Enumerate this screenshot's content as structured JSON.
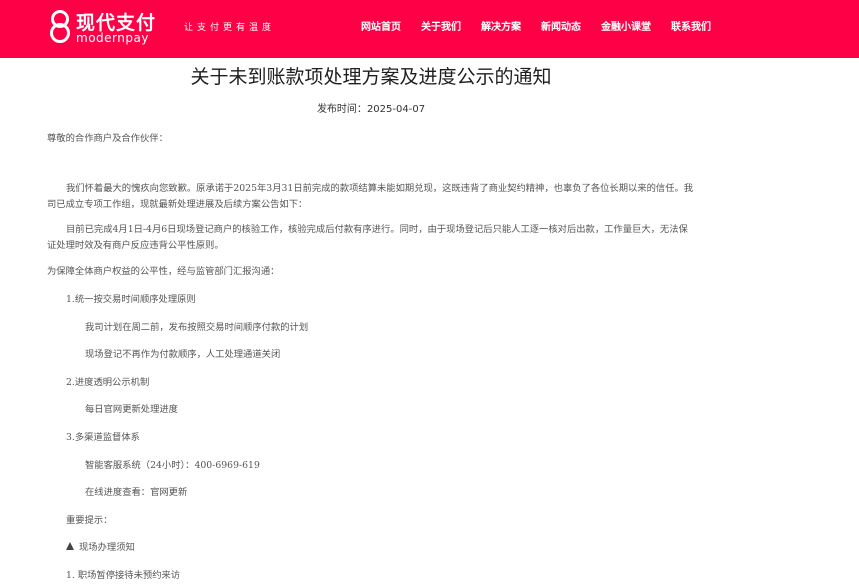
{
  "header": {
    "logo_cn": "现代支付",
    "logo_en": "modernpay",
    "slogan": "让支付更有温度",
    "nav": [
      "网站首页",
      "关于我们",
      "解决方案",
      "新闻动态",
      "金融小课堂",
      "联系我们"
    ]
  },
  "article": {
    "title": "关于未到账款项处理方案及进度公示的通知",
    "date_label": "发布时间：",
    "date": "2025-04-07",
    "salutation": "尊敬的合作商户及合作伙伴：",
    "para1": "我们怀着最大的愧疚向您致歉。原承诺于2025年3月31日前完成的款项结算未能如期兑现，这既违背了商业契约精神，也辜负了各位长期以来的信任。我司已成立专项工作组，现就最新处理进展及后续方案公告如下：",
    "para2": "目前已完成4月1日-4月6日现场登记商户的核验工作，核验完成后付款有序进行。同时，由于现场登记后只能人工逐一核对后出款，工作量巨大，无法保证处理时效及有商户反应违背公平性原则。",
    "para3": "为保障全体商户权益的公平性，经与监管部门汇报沟通：",
    "item1": "1.统一按交易时间顺序处理原则",
    "item1_a": "我司计划在周二前，发布按照交易时间顺序付款的计划",
    "item1_b": "现场登记不再作为付款顺序，人工处理通道关闭",
    "item2": "2.进度透明公示机制",
    "item2_a": "每日官网更新处理进度",
    "item3": "3.多渠道监督体系",
    "item3_a": "智能客服系统（24小时）：400-6969-619",
    "item3_b": "在线进度查看：官网更新",
    "notice": "重要提示：",
    "warn_title": "现场办理须知",
    "warn_1": "1. 职场暂停接待未预约来访"
  }
}
